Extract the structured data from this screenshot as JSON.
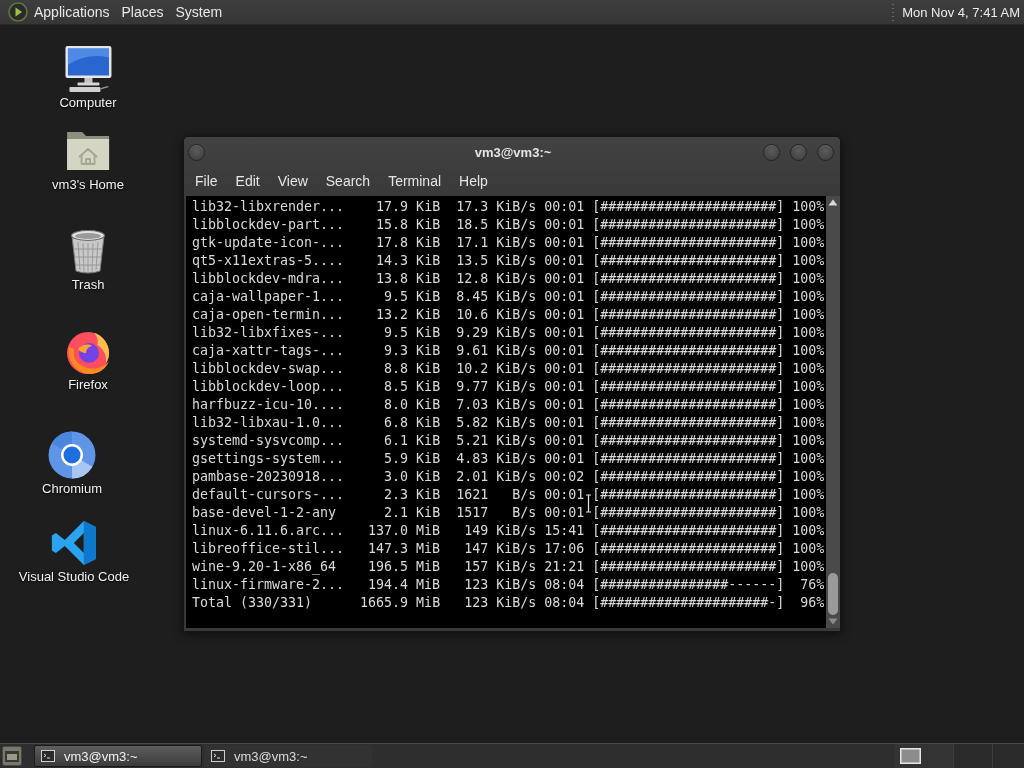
{
  "top_panel": {
    "menus": [
      "Applications",
      "Places",
      "System"
    ],
    "clock": "Mon Nov 4, 7:41 AM"
  },
  "desktop_icons": [
    {
      "label": "Computer",
      "kind": "computer"
    },
    {
      "label": "vm3's Home",
      "kind": "home"
    },
    {
      "label": "Trash",
      "kind": "trash"
    },
    {
      "label": "Firefox",
      "kind": "firefox"
    },
    {
      "label": "Chromium",
      "kind": "chromium"
    },
    {
      "label": "Visual Studio Code",
      "kind": "vscode"
    }
  ],
  "terminal": {
    "title": "vm3@vm3:~",
    "menu": [
      "File",
      "Edit",
      "View",
      "Search",
      "Terminal",
      "Help"
    ],
    "downloads": [
      {
        "name": "lib32-libxrender...",
        "size": "17.9 KiB",
        "rate": "17.3 KiB/s",
        "eta": "00:01",
        "bar": "[######################]",
        "percent": "100%"
      },
      {
        "name": "libblockdev-part...",
        "size": "15.8 KiB",
        "rate": "18.5 KiB/s",
        "eta": "00:01",
        "bar": "[######################]",
        "percent": "100%"
      },
      {
        "name": "gtk-update-icon-...",
        "size": "17.8 KiB",
        "rate": "17.1 KiB/s",
        "eta": "00:01",
        "bar": "[######################]",
        "percent": "100%"
      },
      {
        "name": "qt5-x11extras-5....",
        "size": "14.3 KiB",
        "rate": "13.5 KiB/s",
        "eta": "00:01",
        "bar": "[######################]",
        "percent": "100%"
      },
      {
        "name": "libblockdev-mdra...",
        "size": "13.8 KiB",
        "rate": "12.8 KiB/s",
        "eta": "00:01",
        "bar": "[######################]",
        "percent": "100%"
      },
      {
        "name": "caja-wallpaper-1...",
        "size": "9.5 KiB",
        "rate": "8.45 KiB/s",
        "eta": "00:01",
        "bar": "[######################]",
        "percent": "100%"
      },
      {
        "name": "caja-open-termin...",
        "size": "13.2 KiB",
        "rate": "10.6 KiB/s",
        "eta": "00:01",
        "bar": "[######################]",
        "percent": "100%"
      },
      {
        "name": "lib32-libxfixes-...",
        "size": "9.5 KiB",
        "rate": "9.29 KiB/s",
        "eta": "00:01",
        "bar": "[######################]",
        "percent": "100%"
      },
      {
        "name": "caja-xattr-tags-...",
        "size": "9.3 KiB",
        "rate": "9.61 KiB/s",
        "eta": "00:01",
        "bar": "[######################]",
        "percent": "100%"
      },
      {
        "name": "libblockdev-swap...",
        "size": "8.8 KiB",
        "rate": "10.2 KiB/s",
        "eta": "00:01",
        "bar": "[######################]",
        "percent": "100%"
      },
      {
        "name": "libblockdev-loop...",
        "size": "8.5 KiB",
        "rate": "9.77 KiB/s",
        "eta": "00:01",
        "bar": "[######################]",
        "percent": "100%"
      },
      {
        "name": "harfbuzz-icu-10....",
        "size": "8.0 KiB",
        "rate": "7.03 KiB/s",
        "eta": "00:01",
        "bar": "[######################]",
        "percent": "100%"
      },
      {
        "name": "lib32-libxau-1.0...",
        "size": "6.8 KiB",
        "rate": "5.82 KiB/s",
        "eta": "00:01",
        "bar": "[######################]",
        "percent": "100%"
      },
      {
        "name": "systemd-sysvcomp...",
        "size": "6.1 KiB",
        "rate": "5.21 KiB/s",
        "eta": "00:01",
        "bar": "[######################]",
        "percent": "100%"
      },
      {
        "name": "gsettings-system...",
        "size": "5.9 KiB",
        "rate": "4.83 KiB/s",
        "eta": "00:01",
        "bar": "[######################]",
        "percent": "100%"
      },
      {
        "name": "pambase-20230918...",
        "size": "3.0 KiB",
        "rate": "2.01 KiB/s",
        "eta": "00:02",
        "bar": "[######################]",
        "percent": "100%"
      },
      {
        "name": "default-cursors-...",
        "size": "2.3 KiB",
        "rate": "1621   B/s",
        "eta": "00:01",
        "bar": "[######################]",
        "percent": "100%"
      },
      {
        "name": "base-devel-1-2-any",
        "size": "2.1 KiB",
        "rate": "1517   B/s",
        "eta": "00:01",
        "bar": "[######################]",
        "percent": "100%"
      },
      {
        "name": "linux-6.11.6.arc...",
        "size": "137.0 MiB",
        "rate": "149 KiB/s",
        "eta": "15:41",
        "bar": "[######################]",
        "percent": "100%"
      },
      {
        "name": "libreoffice-stil...",
        "size": "147.3 MiB",
        "rate": "147 KiB/s",
        "eta": "17:06",
        "bar": "[######################]",
        "percent": "100%"
      },
      {
        "name": "wine-9.20-1-x86_64",
        "size": "196.5 MiB",
        "rate": "157 KiB/s",
        "eta": "21:21",
        "bar": "[######################]",
        "percent": "100%"
      },
      {
        "name": "linux-firmware-2...",
        "size": "194.4 MiB",
        "rate": "123 KiB/s",
        "eta": "08:04",
        "bar": "[################------]",
        "percent": "76%"
      },
      {
        "name": "Total (330/331)",
        "size": "1665.9 MiB",
        "rate": "123 KiB/s",
        "eta": "08:04",
        "bar": "[#####################-]",
        "percent": "96%"
      }
    ]
  },
  "taskbar": {
    "tasks": [
      {
        "label": "vm3@vm3:~",
        "selected": true
      },
      {
        "label": "vm3@vm3:~",
        "selected": false
      }
    ]
  }
}
